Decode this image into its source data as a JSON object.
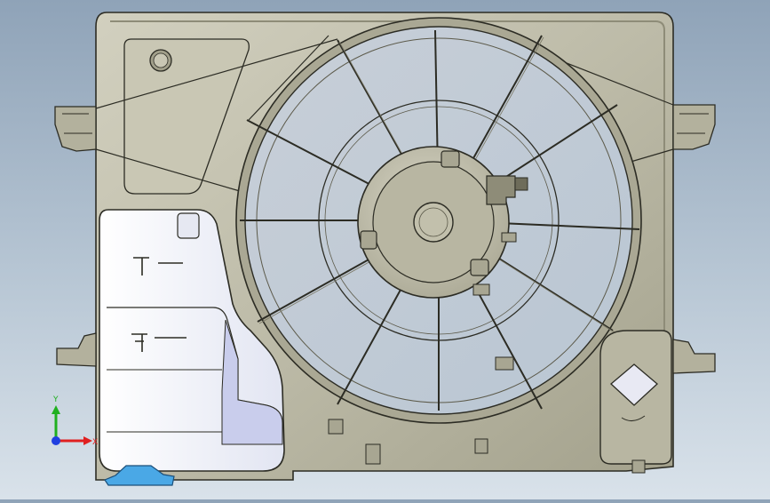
{
  "viewport": {
    "background_top": "#8fa3b8",
    "background_bottom": "#d9e2ea"
  },
  "part": {
    "body_color": "#c4c2b0",
    "body_shadow": "#8e8c78",
    "edge_color": "#2c2c24",
    "tank_color": "#eef0f8",
    "tank_accent": "#c9cdec",
    "spout_color": "#4aa8e6"
  },
  "triad": {
    "x_label": "X",
    "y_label": "Y",
    "x_color": "#e02020",
    "y_color": "#20b020",
    "z_color": "#2040e0"
  }
}
